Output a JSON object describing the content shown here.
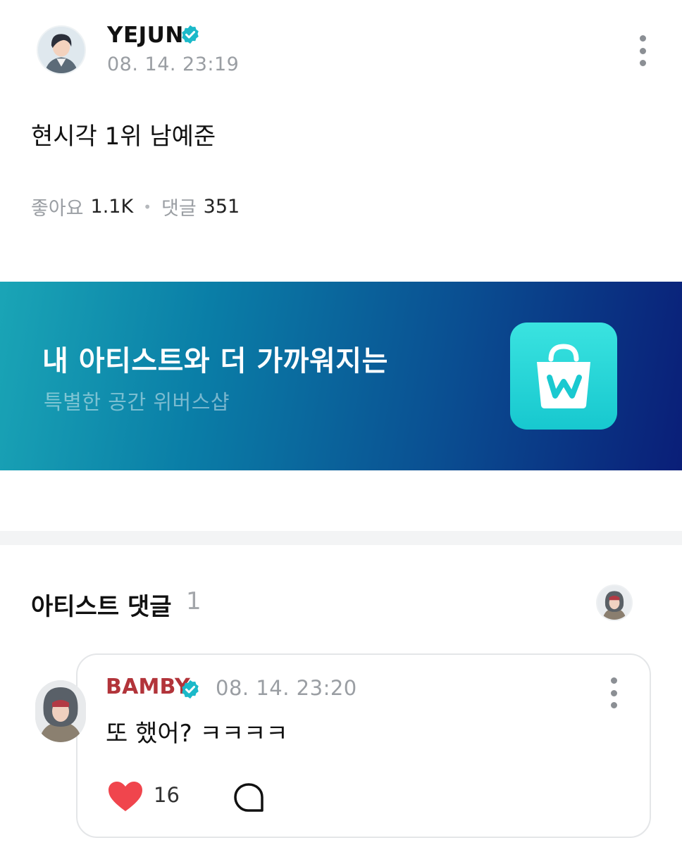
{
  "post": {
    "author": "YEJUN",
    "verified": true,
    "timestamp": "08. 14. 23:19",
    "body": "현시각 1위 남예준",
    "likes_label": "좋아요",
    "likes_count": "1.1K",
    "separator": "•",
    "comments_label": "댓글",
    "comments_count": "351",
    "icons": [
      "verified-badge-icon",
      "more-vertical-icon"
    ]
  },
  "banner": {
    "title": "내 아티스트와 더 가까워지는",
    "subtitle": "특별한 공간 위버스샵",
    "icon": "weverse-shop-bag-icon"
  },
  "artist_comments": {
    "title": "아티스트 댓글",
    "count": "1",
    "comments": [
      {
        "author": "BAMBY",
        "verified": true,
        "timestamp": "08. 14. 23:20",
        "text": "또 했어? ㅋㅋㅋㅋ",
        "like_count": "16",
        "liked": true
      }
    ]
  },
  "colors": {
    "verified_badge": "#1bb9c9",
    "bamby_name": "#b2343a",
    "heart": "#f0454d",
    "banner_start": "#1aa5b6",
    "banner_end": "#0a1e78",
    "shop_icon": "#2bd8d9",
    "muted_text": "#9a9ea3"
  }
}
